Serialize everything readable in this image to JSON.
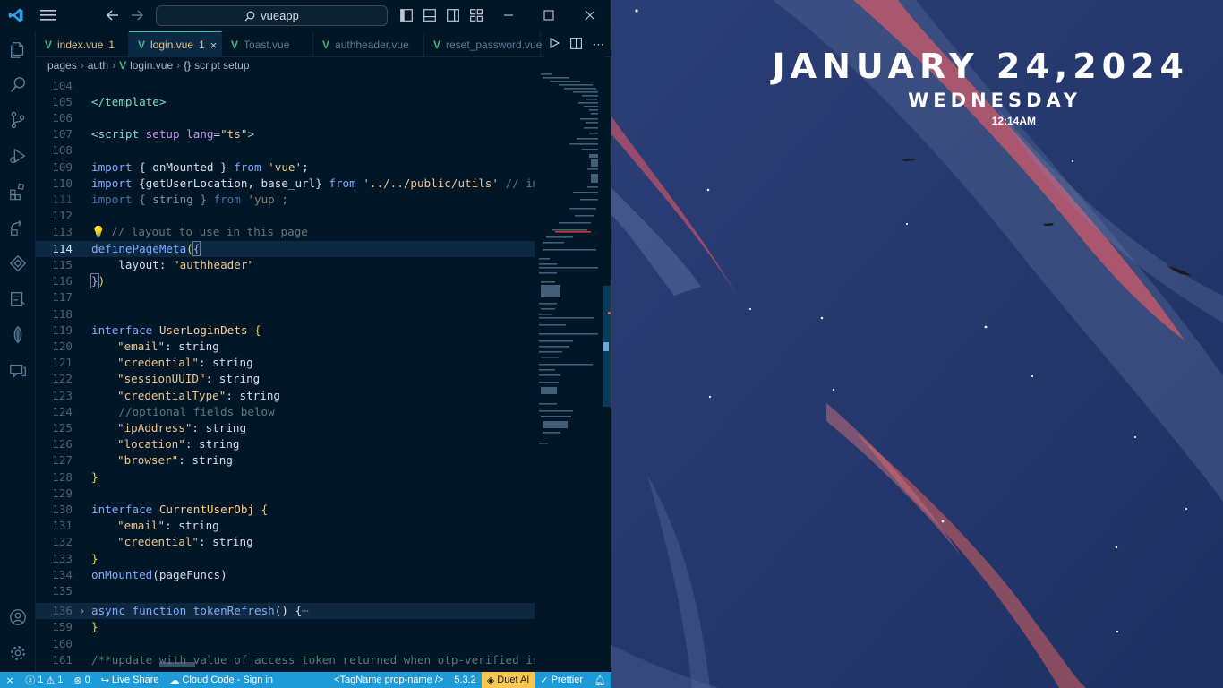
{
  "titlebar": {
    "search_text": "vueapp"
  },
  "tabs": [
    {
      "label": "index.vue",
      "badge": "1"
    },
    {
      "label": "login.vue",
      "badge": "1"
    },
    {
      "label": "Toast.vue",
      "badge": ""
    },
    {
      "label": "authheader.vue",
      "badge": ""
    },
    {
      "label": "reset_password.vue",
      "badge": ""
    }
  ],
  "breadcrumb": {
    "pages": "pages",
    "auth": "auth",
    "file": "login.vue",
    "symbol": "script setup"
  },
  "editor": {
    "lines": [
      {
        "n": "104"
      },
      {
        "n": "105"
      },
      {
        "n": "106"
      },
      {
        "n": "107"
      },
      {
        "n": "108"
      },
      {
        "n": "109"
      },
      {
        "n": "110"
      },
      {
        "n": "111"
      },
      {
        "n": "112"
      },
      {
        "n": "113"
      },
      {
        "n": "114"
      },
      {
        "n": "115"
      },
      {
        "n": "116"
      },
      {
        "n": "117"
      },
      {
        "n": "118"
      },
      {
        "n": "119"
      },
      {
        "n": "120"
      },
      {
        "n": "121"
      },
      {
        "n": "122"
      },
      {
        "n": "123"
      },
      {
        "n": "124"
      },
      {
        "n": "125"
      },
      {
        "n": "126"
      },
      {
        "n": "127"
      },
      {
        "n": "128"
      },
      {
        "n": "129"
      },
      {
        "n": "130"
      },
      {
        "n": "131"
      },
      {
        "n": "132"
      },
      {
        "n": "133"
      },
      {
        "n": "134"
      },
      {
        "n": "135"
      },
      {
        "n": "136"
      },
      {
        "n": "159"
      },
      {
        "n": "160"
      },
      {
        "n": "161"
      }
    ],
    "code": {
      "l105": "</template>",
      "l107a": "<script",
      "l107b": " setup ",
      "l107c": "lang",
      "l107d": "=",
      "l107e": "\"ts\"",
      "l107f": ">",
      "import": "import",
      "from": "from",
      "l109a": " { ",
      "l109b": "onMounted",
      "l109c": " } ",
      "l109d": " 'vue'",
      "l109e": ";",
      "l110a": " {getUserLocation, base_url} ",
      "l110b": " '../../public/utils'",
      "l110c": " // impo",
      "l111a": " { ",
      "l111b": "string",
      "l111c": " } ",
      "l111d": " 'yup'",
      "l111e": ";",
      "l113": "// layout to use in this page",
      "l114a": "definePageMeta",
      "l114b": "(",
      "l114c": "{",
      "l115a": "    layout: ",
      "l115b": "\"authheader\"",
      "l116a": "}",
      "l116b": ")",
      "interface": "interface",
      "l119a": "UserLoginDets",
      "open": " {",
      "k_email": "\"email\"",
      "k_credential": "\"credential\"",
      "k_session": "\"sessionUUID\"",
      "k_credtype": "\"credentialType\"",
      "l124": "    //optional fields below",
      "k_ip": "\"ipAddress\"",
      "k_loc": "\"location\"",
      "k_browser": "\"browser\"",
      "colon_string": ": string",
      "close": "}",
      "l130a": "CurrentUserObj",
      "l134a": "onMounted",
      "l134b": "(pageFuncs)",
      "l136a": "async",
      "l136b": " function ",
      "l136c": "tokenRefresh",
      "l136d": "() {",
      "l136e": "⋯",
      "l161": "/**update with value of access token returned when otp-verified is r"
    }
  },
  "statusbar": {
    "errors": "1",
    "warnings": "1",
    "ports": "0",
    "live_share": "Live Share",
    "cloud_code": "Cloud Code - Sign in",
    "tagname": "<TagName prop-name />",
    "version": "5.3.2",
    "duet": "Duet AI",
    "prettier": "Prettier"
  },
  "wallpaper_clock": {
    "date": "JANUARY 24,2024",
    "day": "WEDNESDAY",
    "time": "12:14AM"
  },
  "colors": {
    "editor_bg": "#011627",
    "statusbar_bg": "#1c9bd8",
    "wallpaper_bg": "#22366a",
    "accent_tab": "#21c7a8"
  }
}
